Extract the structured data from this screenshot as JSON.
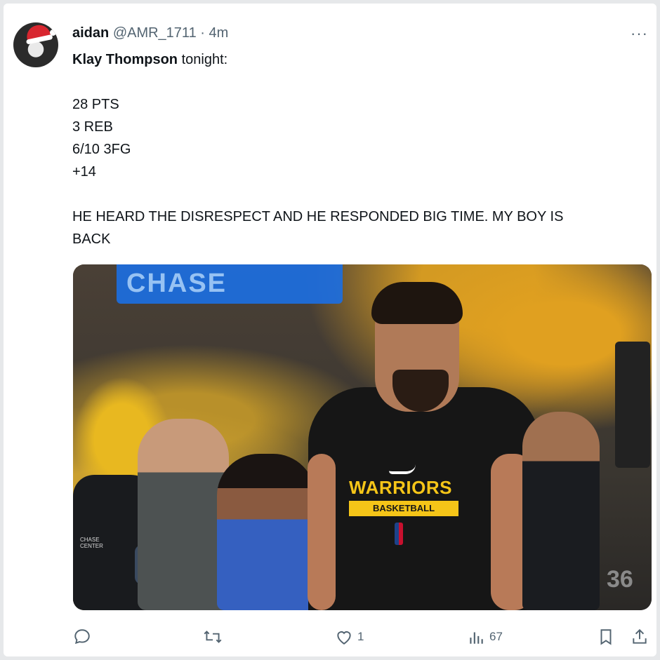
{
  "post": {
    "author_name": "aidan",
    "handle": "@AMR_1711",
    "separator": "·",
    "time": "4m",
    "more_label": "···",
    "text_lines": [
      {
        "bold": "Klay Thompson",
        "rest": " tonight:"
      },
      {
        "bold": "",
        "rest": ""
      },
      {
        "bold": "",
        "rest": "28 PTS"
      },
      {
        "bold": "",
        "rest": "3 REB"
      },
      {
        "bold": "",
        "rest": "6/10 3FG"
      },
      {
        "bold": "",
        "rest": "+14"
      },
      {
        "bold": "",
        "rest": ""
      },
      {
        "bold": "",
        "rest": "HE HEARD THE DISRESPECT AND HE RESPONDED BIG TIME. MY BOY IS"
      },
      {
        "bold": "",
        "rest": "BACK"
      }
    ]
  },
  "media": {
    "arena_sign": "CHASE",
    "jersey_team": "WARRIORS",
    "jersey_sub": "BASKETBALL",
    "patch_text": "CHASE CENTER",
    "sideline_number": "36",
    "colors": {
      "gold": "#f5c518",
      "jersey": "#161616",
      "sign_blue": "#1c6ee0"
    }
  },
  "actions": {
    "reply_count": "",
    "repost_count": "",
    "like_count": "1",
    "views_count": "67",
    "icons": [
      "reply-icon",
      "repost-icon",
      "like-icon",
      "views-icon",
      "bookmark-icon",
      "share-icon"
    ]
  }
}
